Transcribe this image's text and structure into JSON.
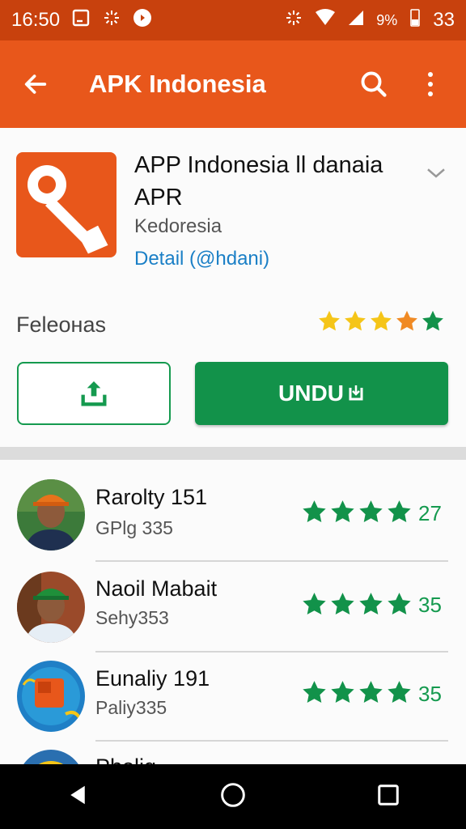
{
  "status_bar": {
    "time": "16:50",
    "battery_percent": "9%",
    "extra": "33"
  },
  "app_bar": {
    "title": "APK Indonesia"
  },
  "app": {
    "name": "APP Indonesia ll danaia APR",
    "developer": "Kedoresia",
    "detail_link": "Detail (@hdani)",
    "rating_label": "Feleонаs",
    "install_label": "UNDU"
  },
  "reviews": [
    {
      "name": "Rarolty 151",
      "sub": "GPlg 335",
      "count": "27"
    },
    {
      "name": "Naoil Mabait",
      "sub": "Sehy353",
      "count": "35"
    },
    {
      "name": "Eunaliy 191",
      "sub": "Paliy335",
      "count": "35"
    },
    {
      "name": "Phelig",
      "sub": "",
      "count": ""
    }
  ],
  "colors": {
    "primary": "#e8571b",
    "status": "#c8410d",
    "green": "#12924a",
    "star_yellow": "#f5c518",
    "star_orange": "#f08a24"
  }
}
